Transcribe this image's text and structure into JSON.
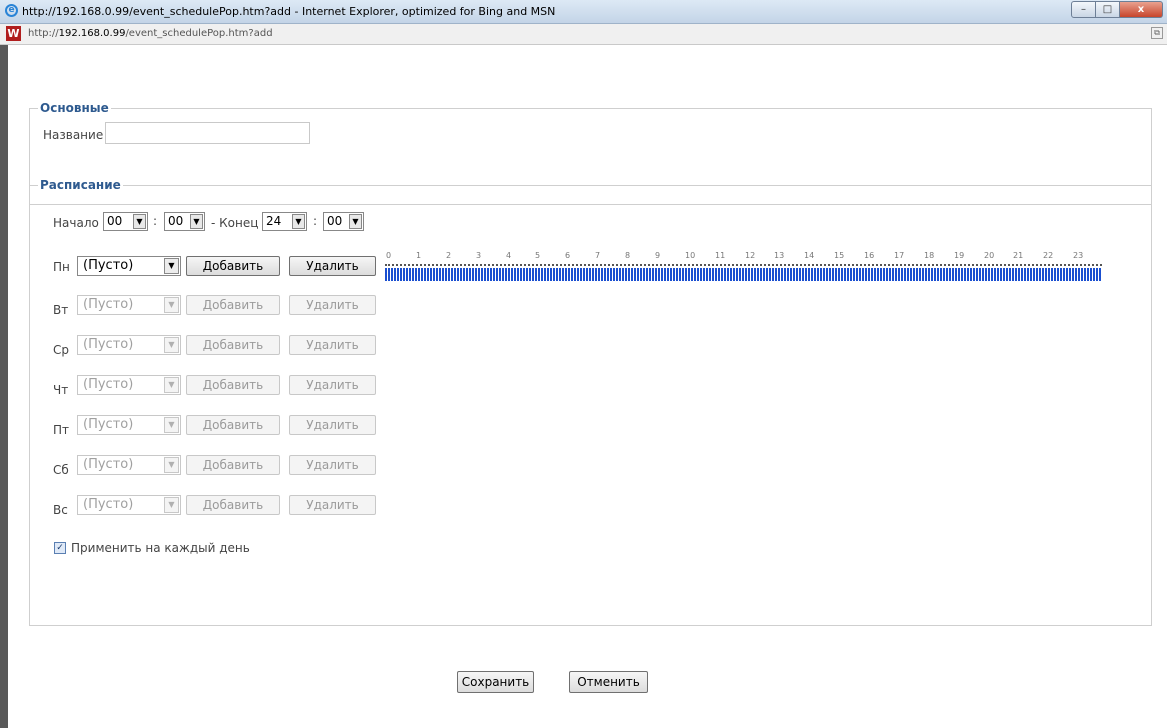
{
  "window": {
    "title": "http://192.168.0.99/event_schedulePop.htm?add - Internet Explorer, optimized for Bing and MSN",
    "controls": {
      "minimize": "–",
      "maximize": "□",
      "close": "x"
    }
  },
  "address_bar": {
    "url_prefix": "http://",
    "url_host": "192.168.0.99",
    "url_path": "/event_schedulePop.htm?add"
  },
  "basic": {
    "legend": "Основные",
    "name_label": "Название",
    "name_value": ""
  },
  "schedule": {
    "legend": "Расписание",
    "start_label": "Начало",
    "start_hour": "00",
    "start_min": "00",
    "colon": ":",
    "end_label": "- Конец",
    "end_hour": "24",
    "end_min": "00",
    "hours": [
      "0",
      "1",
      "2",
      "3",
      "4",
      "5",
      "6",
      "7",
      "8",
      "9",
      "10",
      "11",
      "12",
      "13",
      "14",
      "15",
      "16",
      "17",
      "18",
      "19",
      "20",
      "21",
      "22",
      "23"
    ],
    "days": [
      {
        "label": "Пн",
        "select": "(Пусто)",
        "add": "Добавить",
        "delete": "Удалить",
        "enabled": true
      },
      {
        "label": "Вт",
        "select": "(Пусто)",
        "add": "Добавить",
        "delete": "Удалить",
        "enabled": false
      },
      {
        "label": "Ср",
        "select": "(Пусто)",
        "add": "Добавить",
        "delete": "Удалить",
        "enabled": false
      },
      {
        "label": "Чт",
        "select": "(Пусто)",
        "add": "Добавить",
        "delete": "Удалить",
        "enabled": false
      },
      {
        "label": "Пт",
        "select": "(Пусто)",
        "add": "Добавить",
        "delete": "Удалить",
        "enabled": false
      },
      {
        "label": "Сб",
        "select": "(Пусто)",
        "add": "Добавить",
        "delete": "Удалить",
        "enabled": false
      },
      {
        "label": "Вс",
        "select": "(Пусто)",
        "add": "Добавить",
        "delete": "Удалить",
        "enabled": false
      }
    ],
    "apply_every_day": {
      "label": "Применить на каждый день",
      "checked": true,
      "mark": "✓"
    }
  },
  "footer": {
    "save": "Сохранить",
    "cancel": "Отменить"
  },
  "colors": {
    "legend": "#2e5a8f",
    "timeline": "#1a4fd0"
  }
}
